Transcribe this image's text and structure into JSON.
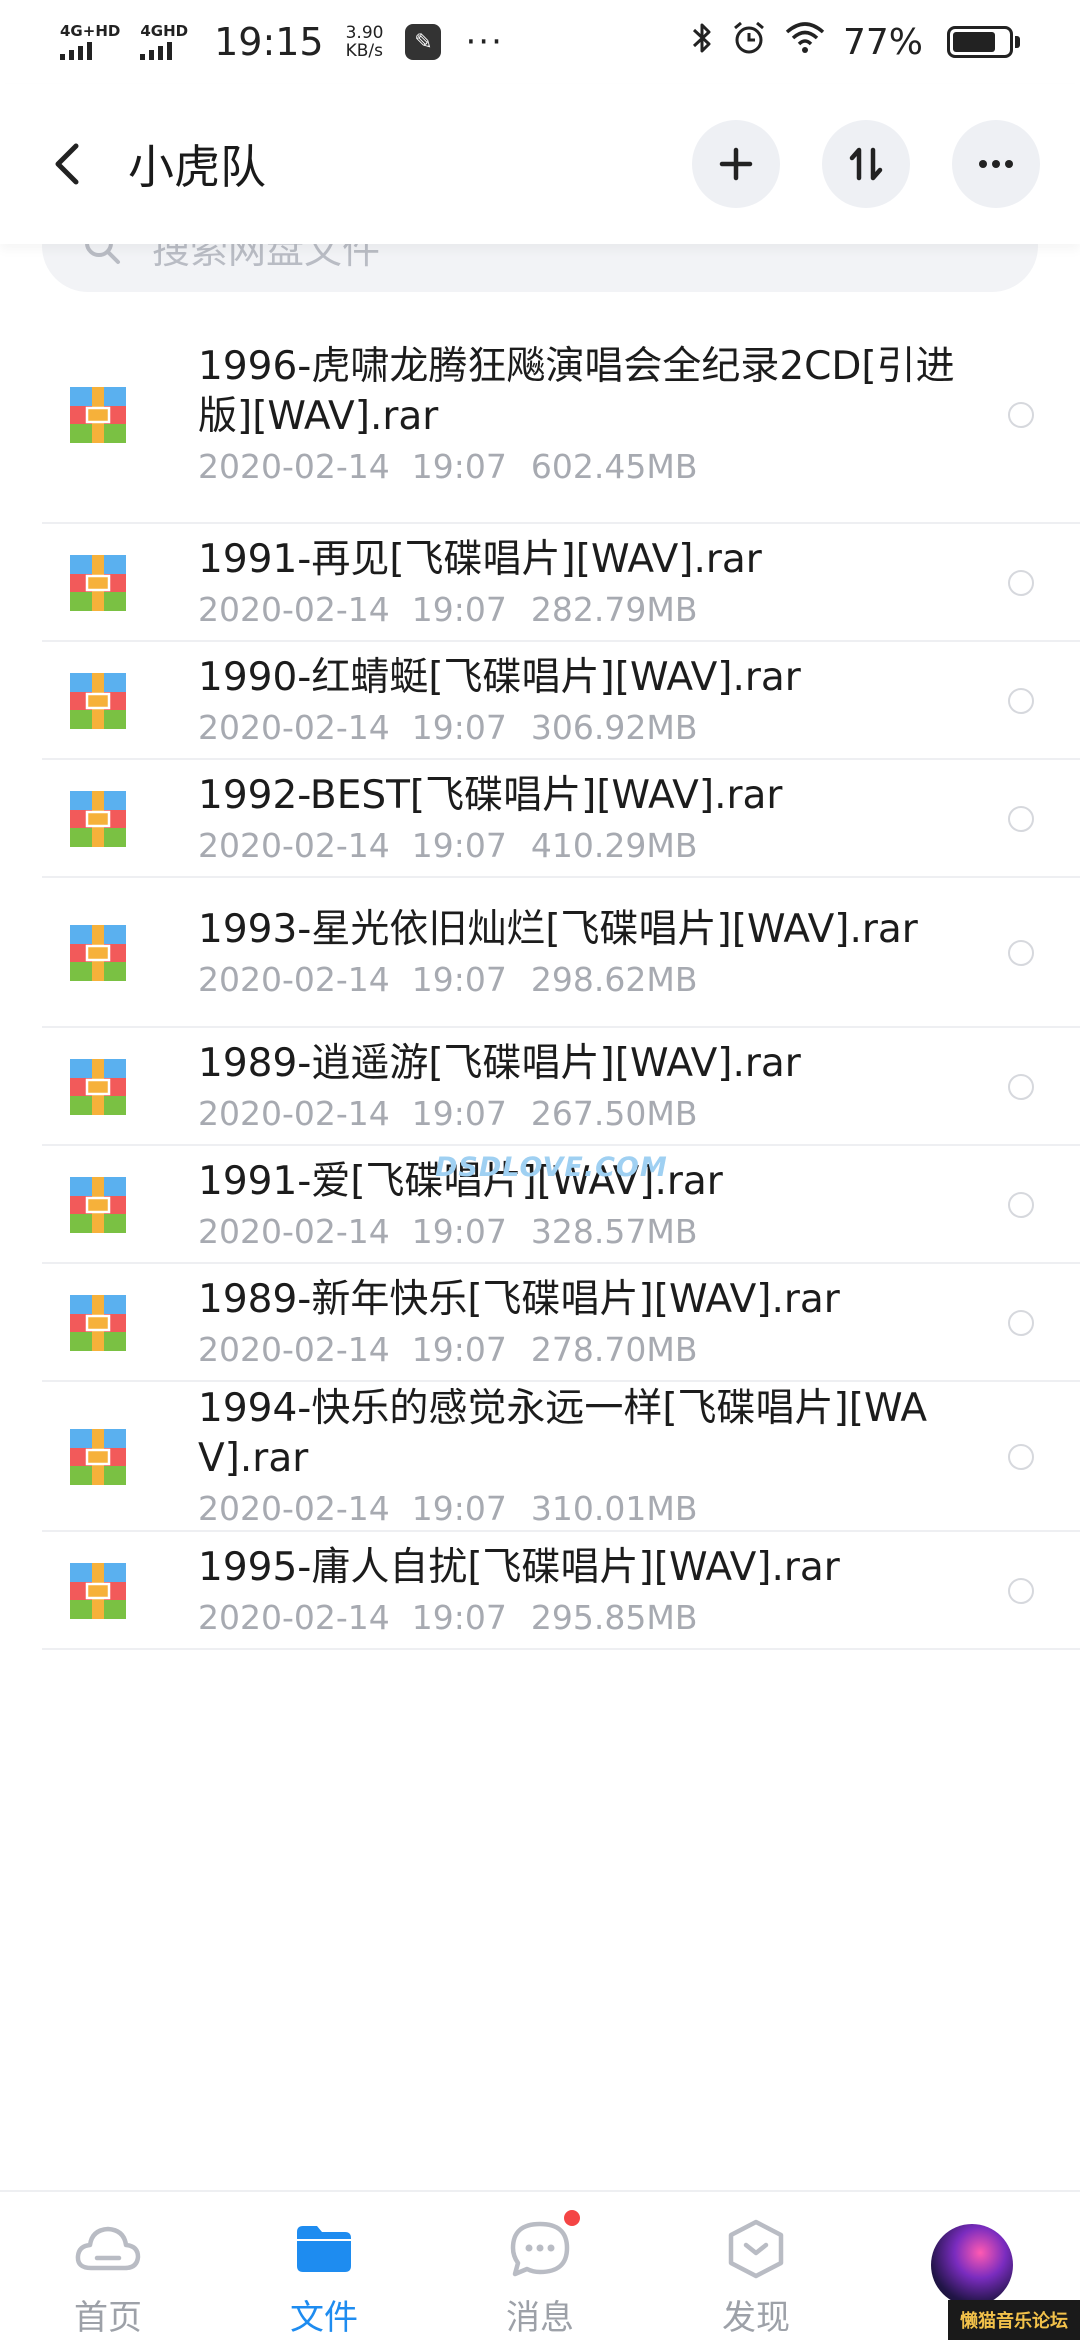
{
  "status_bar": {
    "network_1": "4G+HD",
    "network_2": "4GHD",
    "time": "19:15",
    "speed_value": "3.90",
    "speed_unit": "KB/s",
    "more": "···",
    "battery_percent": "77%",
    "battery_level": 0.77
  },
  "header": {
    "title": "小虎队",
    "back_icon": "chevron-left-icon",
    "actions": [
      "plus-icon",
      "sort-icon",
      "more-icon"
    ]
  },
  "search": {
    "placeholder": "搜索网盘文件"
  },
  "files": [
    {
      "name": "1996-虎啸龙腾狂飚演唱会全纪录2CD[引进版][WAV].rar",
      "date": "2020-02-14",
      "time": "19:07",
      "size": "602.45MB"
    },
    {
      "name": "1991-再见[飞碟唱片][WAV].rar",
      "date": "2020-02-14",
      "time": "19:07",
      "size": "282.79MB"
    },
    {
      "name": "1990-红蜻蜓[飞碟唱片][WAV].rar",
      "date": "2020-02-14",
      "time": "19:07",
      "size": "306.92MB"
    },
    {
      "name": "1992-BEST[飞碟唱片][WAV].rar",
      "date": "2020-02-14",
      "time": "19:07",
      "size": "410.29MB"
    },
    {
      "name": "1993-星光依旧灿烂[飞碟唱片][WAV].rar",
      "date": "2020-02-14",
      "time": "19:07",
      "size": "298.62MB"
    },
    {
      "name": "1989-逍遥游[飞碟唱片][WAV].rar",
      "date": "2020-02-14",
      "time": "19:07",
      "size": "267.50MB"
    },
    {
      "name": "1991-爱[飞碟唱片][WAV].rar",
      "date": "2020-02-14",
      "time": "19:07",
      "size": "328.57MB"
    },
    {
      "name": "1989-新年快乐[飞碟唱片][WAV].rar",
      "date": "2020-02-14",
      "time": "19:07",
      "size": "278.70MB"
    },
    {
      "name": "1994-快乐的感觉永远一样[飞碟唱片][WAV].rar",
      "date": "2020-02-14",
      "time": "19:07",
      "size": "310.01MB"
    },
    {
      "name": "1995-庸人自扰[飞碟唱片][WAV].rar",
      "date": "2020-02-14",
      "time": "19:07",
      "size": "295.85MB"
    }
  ],
  "watermark": "DSDLOVE.COM",
  "bottom_nav": [
    {
      "label": "首页",
      "icon": "cloud-icon",
      "active": false
    },
    {
      "label": "文件",
      "icon": "folder-icon",
      "active": true
    },
    {
      "label": "消息",
      "icon": "message-icon",
      "active": false
    },
    {
      "label": "发现",
      "icon": "discover-icon",
      "active": false
    },
    {
      "label": "",
      "icon": "avatar",
      "active": false
    }
  ],
  "forum_badge": "懒猫音乐论坛",
  "colors": {
    "accent": "#1e8cf0",
    "badge": "#f44545",
    "meta_text": "#a7aab1"
  }
}
